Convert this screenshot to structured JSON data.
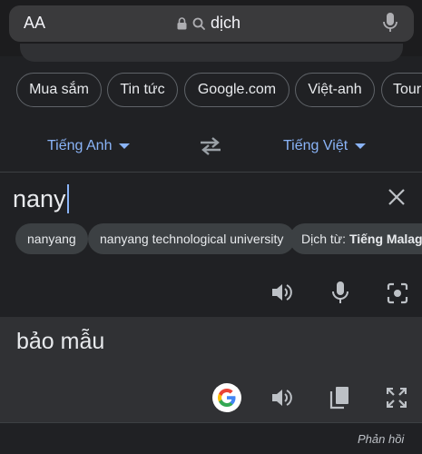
{
  "browser": {
    "text_size_label": "AA",
    "address": "dịch"
  },
  "chips": [
    "Mua sắm",
    "Tin tức",
    "Google.com",
    "Việt-anh",
    "Tour"
  ],
  "translator": {
    "source_language": "Tiếng Anh",
    "target_language": "Tiếng Việt",
    "input_text": "nany",
    "suggestions": [
      "nanyang",
      "nanyang technological university"
    ],
    "detect_label": "Dịch từ:",
    "detect_language": "Tiếng Malag",
    "output_text": "bảo mẫu",
    "feedback_label": "Phản hồi"
  },
  "colors": {
    "accent": "#8ab4f8",
    "background": "#202124",
    "output_background": "#303134"
  },
  "icons": [
    "text-size-icon",
    "lock-icon",
    "search-icon",
    "microphone-icon",
    "swap-icon",
    "close-icon",
    "speaker-icon",
    "microphone-icon",
    "camera-icon",
    "google-icon",
    "copy-icon",
    "fullscreen-icon"
  ]
}
